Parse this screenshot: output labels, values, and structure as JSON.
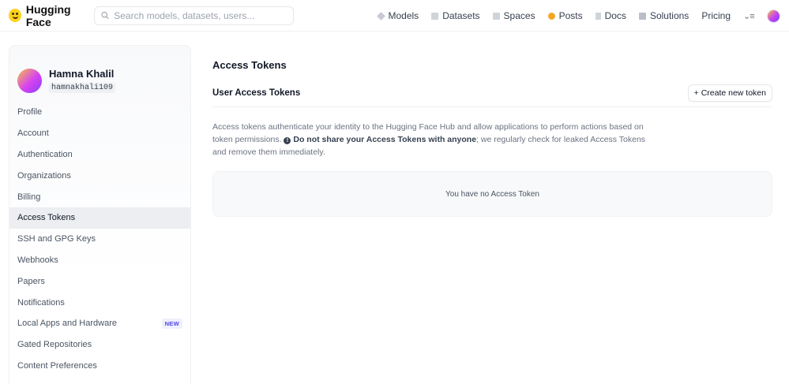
{
  "header": {
    "logo_text": "Hugging Face",
    "search_placeholder": "Search models, datasets, users...",
    "nav": [
      {
        "label": "Models",
        "icon": "cube-icon"
      },
      {
        "label": "Datasets",
        "icon": "database-icon"
      },
      {
        "label": "Spaces",
        "icon": "grid-icon"
      },
      {
        "label": "Posts",
        "icon": "chat-icon"
      },
      {
        "label": "Docs",
        "icon": "book-icon"
      },
      {
        "label": "Solutions",
        "icon": "briefcase-icon"
      },
      {
        "label": "Pricing"
      }
    ],
    "menu_glyph": "⌄≡"
  },
  "sidebar": {
    "name": "Hamna Khalil",
    "username": "hamnakhali109",
    "items": [
      {
        "label": "Profile"
      },
      {
        "label": "Account"
      },
      {
        "label": "Authentication"
      },
      {
        "label": "Organizations"
      },
      {
        "label": "Billing"
      },
      {
        "label": "Access Tokens",
        "active": true
      },
      {
        "label": "SSH and GPG Keys"
      },
      {
        "label": "Webhooks"
      },
      {
        "label": "Papers"
      },
      {
        "label": "Notifications"
      },
      {
        "label": "Local Apps and Hardware",
        "badge": "NEW"
      },
      {
        "label": "Gated Repositories"
      },
      {
        "label": "Content Preferences"
      }
    ]
  },
  "main": {
    "title": "Access Tokens",
    "section_title": "User Access Tokens",
    "create_button": "+ Create new token",
    "desc_part1": "Access tokens authenticate your identity to the Hugging Face Hub and allow applications to perform actions based on token permissions. ",
    "warning_glyph": "!",
    "desc_bold": "Do not share your Access Tokens with anyone",
    "desc_part2": "; we regularly check for leaked Access Tokens and remove them immediately.",
    "empty_text": "You have no Access Token"
  }
}
